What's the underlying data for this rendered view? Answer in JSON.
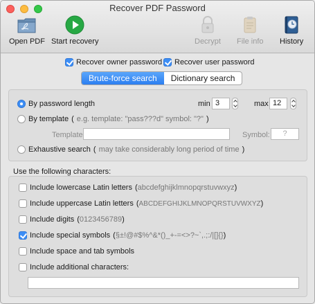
{
  "window": {
    "title": "Recover PDF Password"
  },
  "toolbar": {
    "open_pdf": "Open PDF",
    "start_recovery": "Start recovery",
    "decrypt": "Decrypt",
    "file_info": "File info",
    "history": "History"
  },
  "options": {
    "recover_owner": "Recover owner password",
    "recover_owner_checked": true,
    "recover_user": "Recover user password",
    "recover_user_checked": true
  },
  "tabs": {
    "brute_force": "Brute-force search",
    "dictionary": "Dictionary search",
    "active": "brute_force"
  },
  "brute": {
    "by_length_label": "By password length",
    "min_label": "min",
    "min_value": "3",
    "max_label": "max",
    "max_value": "12",
    "by_template_label": "By template",
    "template_hint_open": "(",
    "template_hint": "e.g. template: \"pass???d\" symbol: \"?\"",
    "template_hint_close": ")",
    "template_field_label": "Template:",
    "template_value": "",
    "symbol_label": "Symbol:",
    "symbol_placeholder": "?",
    "exhaustive_label": "Exhaustive search",
    "exhaustive_hint_open": "(",
    "exhaustive_hint": "may take considerably long period of time",
    "exhaustive_hint_close": ")",
    "selected_mode": "length"
  },
  "charset": {
    "heading": "Use the following characters:",
    "lowercase_label": "Include lowercase Latin letters",
    "lowercase_sample": "abcdefghijklmnopqrstuvwxyz",
    "uppercase_label": "Include uppercase Latin letters",
    "uppercase_sample": "ABCDEFGHIJKLMNOPQRSTUVWXYZ",
    "digits_label": "Include digits",
    "digits_sample": "0123456789",
    "special_label": "Include special symbols",
    "special_sample": "§±!@#$%^&*()_+-=<>?~`,.;:/|[]{}",
    "space_label": "Include space and tab symbols",
    "additional_label": "Include additional characters:",
    "additional_value": "",
    "special_checked": true
  },
  "colors": {
    "accent": "#3d8ef5",
    "play_green": "#27a844"
  }
}
